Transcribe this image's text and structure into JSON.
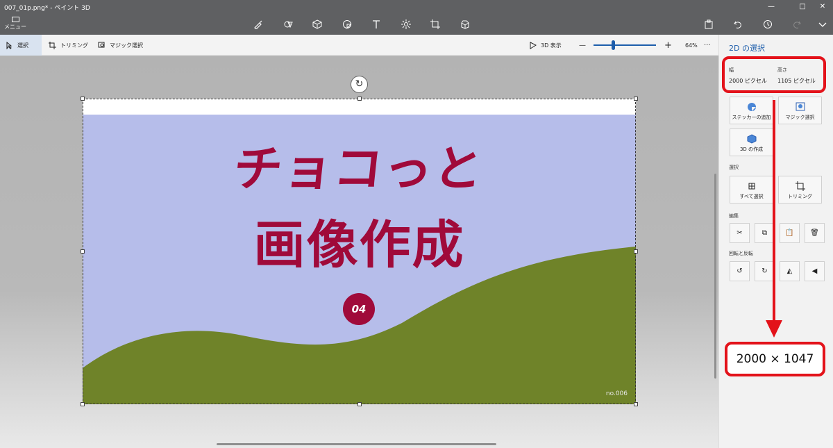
{
  "window": {
    "title": "007_01p.png* - ペイント 3D",
    "controls": [
      "—",
      "□",
      "✕"
    ]
  },
  "toolbar": {
    "menu_label": "メニュー",
    "tools": [
      "brushes-icon",
      "2d-shapes-icon",
      "3d-shapes-icon",
      "stickers-icon",
      "text-icon",
      "effects-icon",
      "canvas-icon",
      "3d-library-icon"
    ],
    "right_tools": [
      "paste-icon",
      "undo-icon",
      "history-icon",
      "redo-icon",
      "expand-icon"
    ]
  },
  "commandbar": {
    "select_label": "選択",
    "crop_label": "トリミング",
    "magic_label": "マジック選択",
    "view3d_label": "3D 表示",
    "zoom_minus": "—",
    "zoom_plus": "+",
    "zoom_value": "64%",
    "more": "···"
  },
  "artwork": {
    "line1": "チョコっと",
    "line2": "画像作成",
    "badge": "04",
    "footer_label": "no.006"
  },
  "panel": {
    "title": "2D の選択",
    "width_label": "幅",
    "height_label": "高さ",
    "width_value": "2000 ピクセル",
    "height_value": "1105 ピクセル",
    "sticker_label": "ステッカーの追加",
    "magic_label": "マジック選択",
    "make3d_label": "3D の作成",
    "section_select": "選択",
    "select_all_label": "すべて選択",
    "crop_label": "トリミング",
    "section_edit": "編集",
    "section_rotate": "回転と反転"
  },
  "annotation": {
    "result": "2000 × 1047",
    "color": "#e3121a"
  },
  "colors": {
    "accent": "#1c5dab",
    "title_text": "#a00a3a",
    "sky": "#b6bdea",
    "hill": "#6f8329"
  }
}
